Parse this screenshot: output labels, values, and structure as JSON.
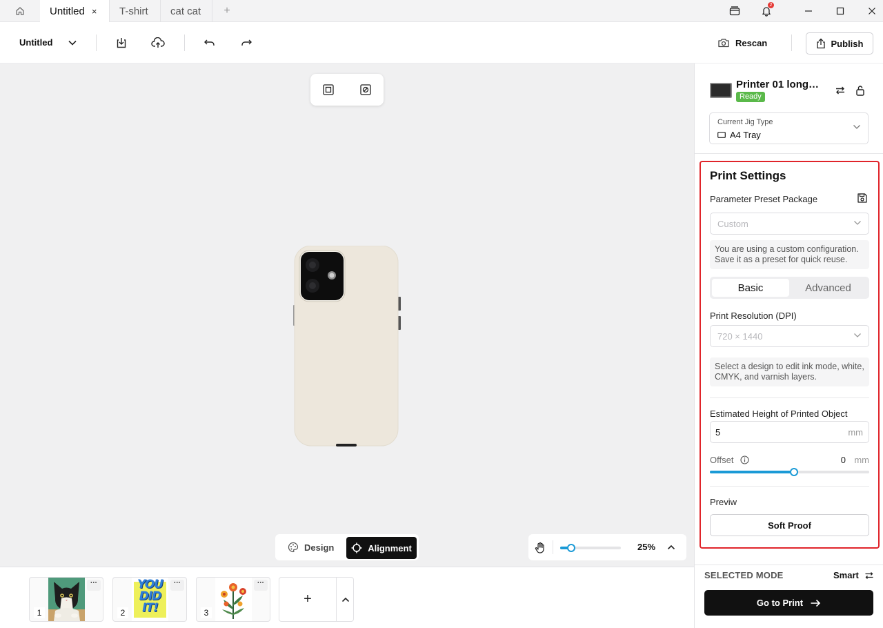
{
  "tabs": [
    {
      "label": "Untitled",
      "active": true
    },
    {
      "label": "T-shirt",
      "active": false
    },
    {
      "label": "cat cat",
      "active": false
    }
  ],
  "tab_add_label": "+",
  "tab_close_label": "×",
  "notification_count": "2",
  "toolbar": {
    "doc_title": "Untitled",
    "rescan_label": "Rescan",
    "publish_label": "Publish"
  },
  "canvas": {
    "mode_design_label": "Design",
    "mode_alignment_label": "Alignment",
    "zoom_value": "25%",
    "zoom_fraction": 0.18
  },
  "thumbnails": [
    {
      "num": "1",
      "more": "···",
      "art": "cat-photo"
    },
    {
      "num": "2",
      "more": "···",
      "art": "you-did-it-text",
      "art_text": [
        "YOU",
        "DID",
        "IT!"
      ]
    },
    {
      "num": "3",
      "more": "···",
      "art": "flower-illustration"
    }
  ],
  "thumb_add_label": "+",
  "printer": {
    "name": "Printer 01 long l...",
    "status": "Ready",
    "jig_label": "Current Jig Type",
    "jig_value": "A4 Tray"
  },
  "print_settings": {
    "title": "Print Settings",
    "preset_label": "Parameter Preset Package",
    "preset_placeholder": "Custom",
    "preset_note": "You are using a custom configuration. Save it as a preset for quick reuse.",
    "tab_basic": "Basic",
    "tab_advanced": "Advanced",
    "resolution_label": "Print Resolution (DPI)",
    "resolution_placeholder": "720 × 1440",
    "design_note": "Select a design to edit ink mode, white, CMYK, and varnish layers.",
    "height_label": "Estimated Height of Printed Object",
    "height_value": "5",
    "height_unit": "mm",
    "offset_label": "Offset",
    "offset_value": "0",
    "offset_unit": "mm",
    "offset_fraction": 0.53,
    "preview_label": "Previw",
    "soft_proof_label": "Soft Proof"
  },
  "footer": {
    "selected_mode_label": "SELECTED MODE",
    "selected_mode_value": "Smart",
    "go_print_label": "Go to Print"
  },
  "colors": {
    "accent": "#1a9ad6",
    "ready": "#5ab94a",
    "highlight_border": "#e0242a",
    "badge": "#e53935"
  }
}
